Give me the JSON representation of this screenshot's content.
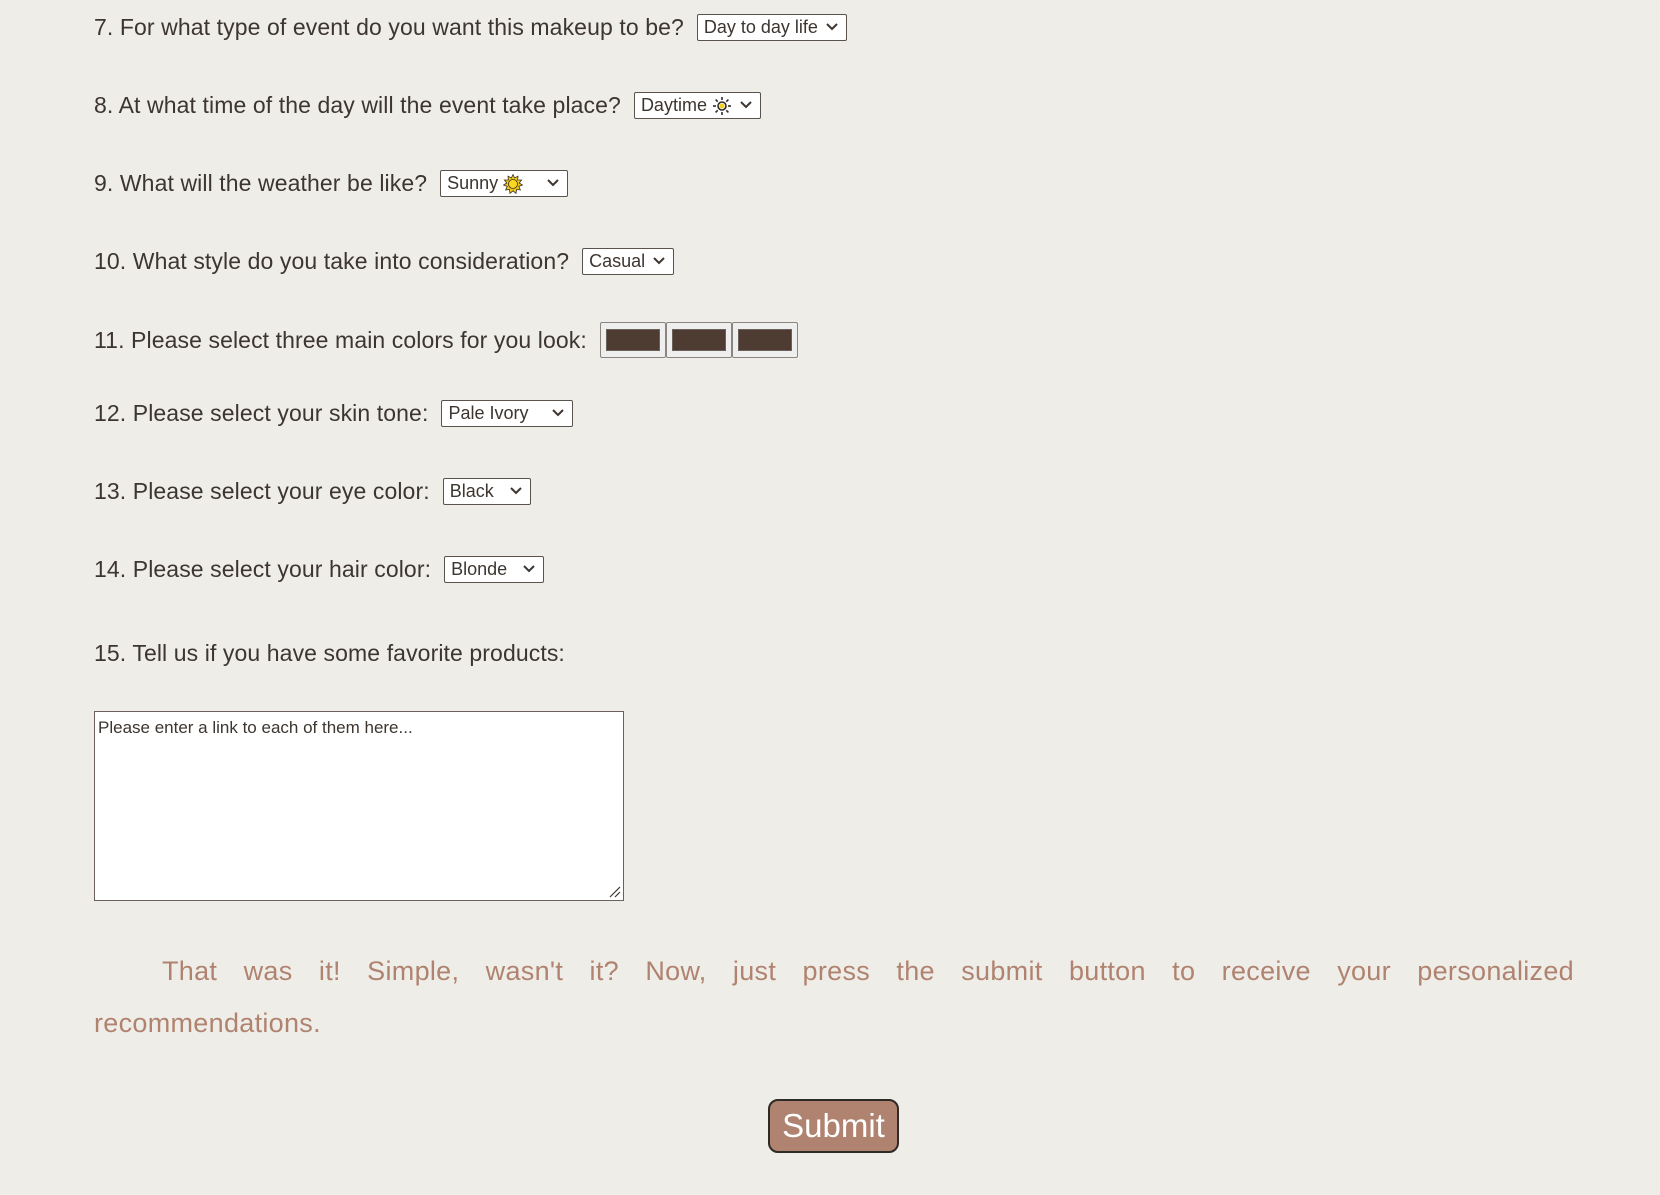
{
  "colors": {
    "background": "#efede8",
    "text": "#3c3530",
    "accent": "#b08370",
    "swatch": "#4e3b31"
  },
  "questions": {
    "q7": {
      "label": "7. For what type of event do you want this makeup to be?",
      "value": "Day to day life"
    },
    "q8": {
      "label": "8. At what time of the day will the event take place?",
      "value": "Daytime",
      "icon": "sun-outline-icon"
    },
    "q9": {
      "label": "9. What will the weather be like?",
      "value": "Sunny",
      "icon": "sun-yellow-icon"
    },
    "q10": {
      "label": "10. What style do you take into consideration?",
      "value": "Casual"
    },
    "q11": {
      "label": "11. Please select three main colors for you look:",
      "colors": [
        "#4e3b31",
        "#4e3b31",
        "#4e3b31"
      ]
    },
    "q12": {
      "label": "12. Please select your skin tone:",
      "value": "Pale Ivory"
    },
    "q13": {
      "label": "13. Please select your eye color:",
      "value": "Black"
    },
    "q14": {
      "label": "14. Please select your hair color:",
      "value": "Blonde"
    },
    "q15": {
      "label": "15. Tell us if you have some favorite products:",
      "placeholder": "Please enter a link to each of them here..."
    }
  },
  "closing": {
    "text": "That was it! Simple, wasn't it? Now, just press the submit button to receive your personalized recommendations."
  },
  "submit": {
    "label": "Submit"
  }
}
